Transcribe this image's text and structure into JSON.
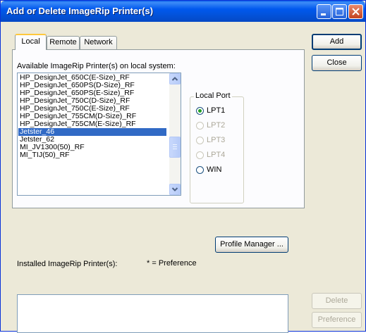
{
  "window": {
    "title": "Add or Delete ImageRip Printer(s)"
  },
  "tabs": [
    {
      "label": "Local"
    },
    {
      "label": "Remote"
    },
    {
      "label": "Network"
    }
  ],
  "local": {
    "available_label": "Available ImageRip Printer(s) on local system:",
    "printers": [
      "HP_DesignJet_650C(E-Size)_RF",
      "HP_DesignJet_650PS(D-Size)_RF",
      "HP_DesignJet_650PS(E-Size)_RF",
      "HP_DesignJet_750C(D-Size)_RF",
      "HP_DesignJet_750C(E-Size)_RF",
      "HP_DesignJet_755CM(D-Size)_RF",
      "HP_DesignJet_755CM(E-Size)_RF",
      "Jetster_46",
      "Jetster_62",
      "MI_JV1300(50)_RF",
      "MI_TIJ(50)_RF"
    ],
    "selected_printer": "Jetster_46",
    "port_group_title": "Local Port",
    "ports": [
      {
        "label": "LPT1",
        "checked": true,
        "enabled": true
      },
      {
        "label": "LPT2",
        "checked": false,
        "enabled": false
      },
      {
        "label": "LPT3",
        "checked": false,
        "enabled": false
      },
      {
        "label": "LPT4",
        "checked": false,
        "enabled": false
      },
      {
        "label": "WIN",
        "checked": false,
        "enabled": true
      }
    ]
  },
  "buttons": {
    "add": "Add",
    "close": "Close",
    "profile_manager": "Profile Manager ...",
    "delete": "Delete",
    "preference": "Preference"
  },
  "installed": {
    "label": "Installed ImageRip Printer(s):",
    "preference_note": "* = Preference",
    "items": []
  },
  "colors": {
    "selection": "#316ac5",
    "titlebar": "#0058ee"
  }
}
